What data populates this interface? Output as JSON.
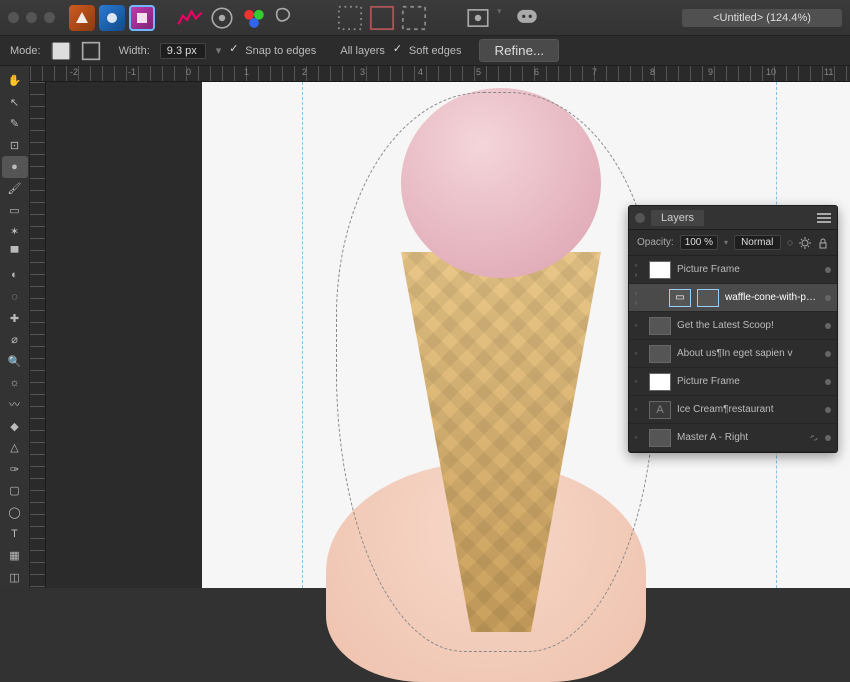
{
  "document_title": "<Untitled> (124.4%)",
  "optbar": {
    "mode_label": "Mode:",
    "width_label": "Width:",
    "width_value": "9.3 px",
    "snap": "Snap to edges",
    "all": "All layers",
    "soft": "Soft edges",
    "refine": "Refine..."
  },
  "ruler_unit": "cm",
  "ruler_marks": [
    "-2",
    "-1",
    "0",
    "1",
    "2",
    "3",
    "4",
    "5",
    "6",
    "7",
    "8",
    "9",
    "10",
    "11"
  ],
  "panel": {
    "title": "Layers",
    "opacity_label": "Opacity:",
    "opacity_value": "100 %",
    "blend_mode": "Normal",
    "layers": [
      {
        "name": "Picture Frame",
        "kind": "pf",
        "selected": false
      },
      {
        "name": "waffle-cone-with-p…",
        "kind": "img",
        "selected": true,
        "indent": 1
      },
      {
        "name": "Get the Latest Scoop!",
        "kind": "text",
        "selected": false
      },
      {
        "name": "About us¶In eget sapien v",
        "kind": "text",
        "selected": false
      },
      {
        "name": "Picture Frame",
        "kind": "pf",
        "selected": false
      },
      {
        "name": "Ice Cream¶restaurant",
        "kind": "atext",
        "selected": false
      },
      {
        "name": "Master A - Right",
        "kind": "master",
        "selected": false,
        "linked": true
      }
    ]
  },
  "tools": [
    "hand-tool",
    "move-tool",
    "pen-tool",
    "crop-tool",
    "selection-brush-tool",
    "paint-brush-tool",
    "marquee-tool",
    "flood-select-tool",
    "gradient-tool",
    "color-picker-tool",
    "erase-tool",
    "heal-tool",
    "clone-tool",
    "zoom-tool",
    "dodge-tool",
    "smudge-tool",
    "sponge-tool",
    "blur-tool",
    "vector-brush-tool",
    "rectangle-tool",
    "shape-tool",
    "text-frame-tool",
    "table-tool",
    "asset-tool"
  ],
  "selected_tool_index": 4
}
